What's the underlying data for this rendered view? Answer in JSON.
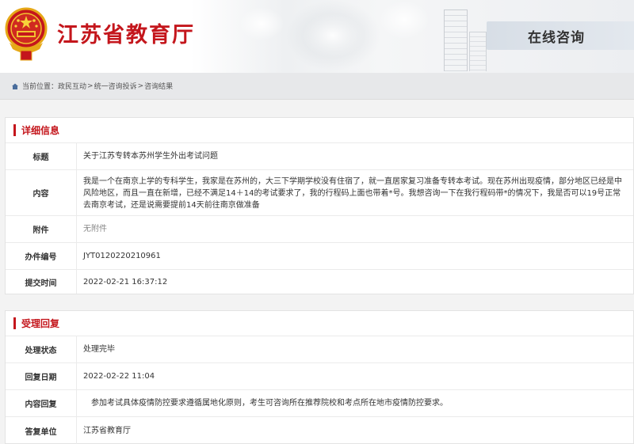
{
  "header": {
    "site_title": "江苏省教育厅",
    "section_tag": "在线咨询",
    "colors": {
      "brand_red": "#c4161c"
    }
  },
  "breadcrumb": {
    "prefix": "当前位置：",
    "items": [
      "政民互动",
      "统一咨询投诉",
      "咨询结果"
    ],
    "separator": ">"
  },
  "detail": {
    "heading": "详细信息",
    "rows": [
      {
        "label": "标题",
        "value": "关于江苏专转本苏州学生外出考试问题"
      },
      {
        "label": "内容",
        "value": "我是一个在南京上学的专科学生，我家是在苏州的，大三下学期学校没有住宿了，就一直居家复习准备专转本考试。现在苏州出现疫情，部分地区已经是中风险地区，而且一直在新增，已经不满足14＋14的考试要求了，我的行程码上面也带着*号。我想咨询一下在我行程码带*的情况下，我是否可以19号正常去南京考试，还是说需要提前14天前往南京做准备"
      },
      {
        "label": "附件",
        "value": "无附件"
      },
      {
        "label": "办件编号",
        "value": "JYT0120220210961"
      },
      {
        "label": "提交时间",
        "value": "2022-02-21 16:37:12"
      }
    ]
  },
  "reply": {
    "heading": "受理回复",
    "rows": [
      {
        "label": "处理状态",
        "value": "处理完毕"
      },
      {
        "label": "回复日期",
        "value": "2022-02-22 11:04"
      },
      {
        "label": "内容回复",
        "value": "参加考试具体疫情防控要求遵循属地化原则，考生可咨询所在推荐院校和考点所在地市疫情防控要求。"
      },
      {
        "label": "答复单位",
        "value": "江苏省教育厅"
      }
    ]
  }
}
